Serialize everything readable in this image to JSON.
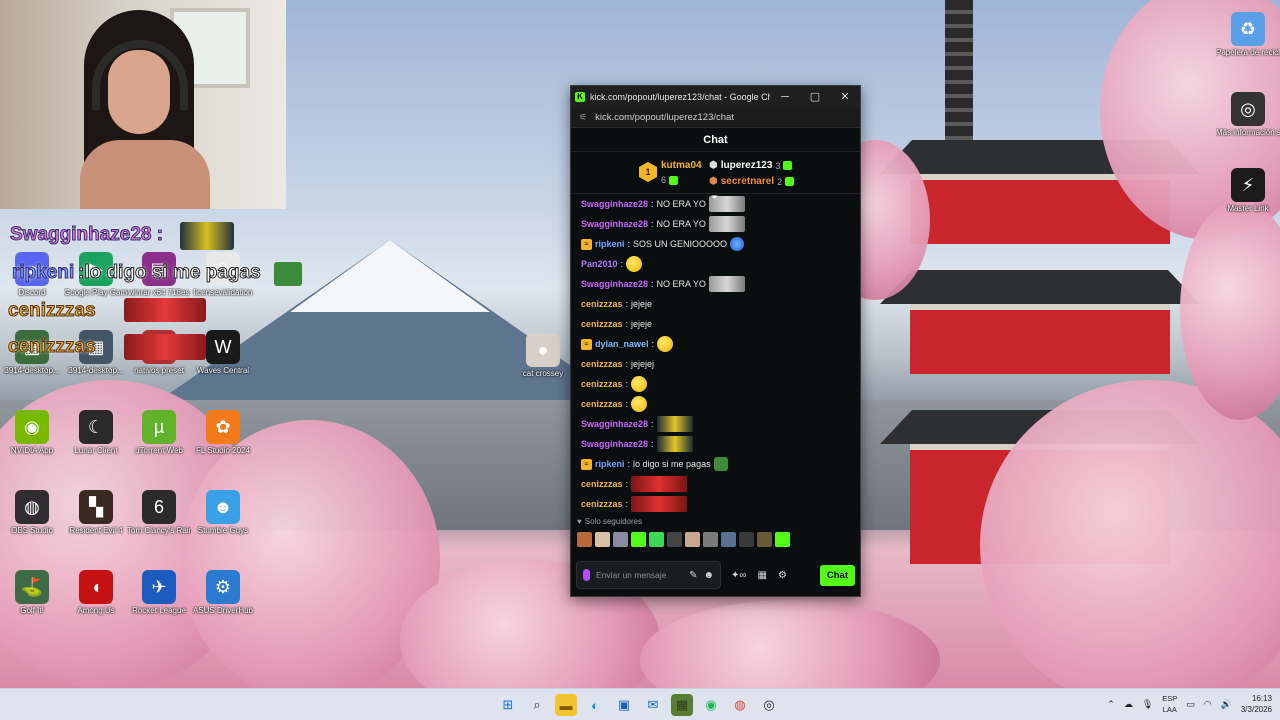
{
  "desktop": {
    "overlay": {
      "swagginhaze_name": "Swagginhaze28",
      "swagginhaze_colon": ":",
      "ripkeni_name": "ripkeni",
      "ripkeni_message": ":lo digo si me pagas",
      "cenizzzas_1": "cenizzzas",
      "cenizzzas_2": "cenizzzas"
    },
    "icons": [
      {
        "label": "Discord",
        "icon": "discord-icon",
        "color": "#5865f2",
        "glyph": "◕"
      },
      {
        "label": "Google Play Games",
        "icon": "google-play-games-icon",
        "color": "#1aa260",
        "glyph": "▶"
      },
      {
        "label": "winrar x64 718es",
        "icon": "winrar-icon",
        "color": "#8c2e8c",
        "glyph": "▤"
      },
      {
        "label": "licensevalidation",
        "icon": "file-icon",
        "color": "#e9e9e9",
        "glyph": "▯"
      },
      {
        "label": "3914-desktop...",
        "icon": "desktop-file-icon",
        "color": "#3b6c3b",
        "glyph": "▦"
      },
      {
        "label": "3914-desktop...",
        "icon": "desktop-file-icon",
        "color": "#445566",
        "glyph": "▦"
      },
      {
        "label": "nativos preset",
        "icon": "preset-icon",
        "color": "#b03030",
        "glyph": "▣"
      },
      {
        "label": "Waves Central",
        "icon": "waves-central-icon",
        "color": "#1a1a1a",
        "glyph": "W"
      },
      {
        "label": "cat crossey",
        "icon": "cat-icon",
        "color": "#d8d0c8",
        "glyph": "●"
      },
      {
        "label": "NVIDIA App",
        "icon": "nvidia-icon",
        "color": "#76b900",
        "glyph": "◉"
      },
      {
        "label": "Lunar Client",
        "icon": "lunar-client-icon",
        "color": "#2a2a2a",
        "glyph": "☾"
      },
      {
        "label": "uTorrent Web",
        "icon": "utorrent-icon",
        "color": "#62b22c",
        "glyph": "µ"
      },
      {
        "label": "FL Studio 2024",
        "icon": "fl-studio-icon",
        "color": "#f27a1a",
        "glyph": "✿"
      },
      {
        "label": "OBS Studio",
        "icon": "obs-icon",
        "color": "#302e31",
        "glyph": "◍"
      },
      {
        "label": "Resident Evil 4",
        "icon": "resident-evil-icon",
        "color": "#3a2a22",
        "glyph": "▚"
      },
      {
        "label": "Tom Clancy's Rainbow Six",
        "icon": "rainbow-six-icon",
        "color": "#2b2b2b",
        "glyph": "6"
      },
      {
        "label": "Stumble Guys",
        "icon": "stumble-guys-icon",
        "color": "#3aa0e6",
        "glyph": "☻"
      },
      {
        "label": "Golf It!",
        "icon": "golf-it-icon",
        "color": "#3d6b46",
        "glyph": "⛳"
      },
      {
        "label": "Among Us",
        "icon": "among-us-icon",
        "color": "#c51111",
        "glyph": "◖"
      },
      {
        "label": "Rocket League",
        "icon": "rocket-league-icon",
        "color": "#1d5bbf",
        "glyph": "✈"
      },
      {
        "label": "ASUS DriverHub",
        "icon": "asus-driverhub-icon",
        "color": "#2d7bd0",
        "glyph": "⚙"
      },
      {
        "label": "Papelera de reciclaje",
        "icon": "recycle-bin-icon",
        "color": "#5aa0e8",
        "glyph": "♻"
      },
      {
        "label": "Más información sobre esta ima...",
        "icon": "info-camera-icon",
        "color": "#333",
        "glyph": "◎"
      },
      {
        "label": "Master Link",
        "icon": "master-link-icon",
        "color": "#1b1b1b",
        "glyph": "⚡"
      }
    ]
  },
  "window": {
    "title": "kick.com/popout/luperez123/chat - Google Chrome",
    "url": "kick.com/popout/luperez123/chat",
    "minimize": "─",
    "maximize": "▢",
    "close": "✕"
  },
  "chat": {
    "header": "Chat",
    "leaderboard": {
      "first": {
        "rank": "1",
        "name": "kutma04",
        "count": "6"
      },
      "second": {
        "name": "luperez123",
        "count": "3"
      },
      "third": {
        "name": "secretnarel",
        "count": "2"
      }
    },
    "pinned_indicator": "⏷",
    "messages": [
      {
        "user": "Swagginhaze28",
        "sep": ":",
        "text": "NO ERA YO",
        "color": "#c766ff",
        "badge": "",
        "emote": "pic"
      },
      {
        "user": "Swagginhaze28",
        "sep": ":",
        "text": "NO ERA YO",
        "color": "#c766ff",
        "badge": "",
        "emote": "pic"
      },
      {
        "user": "ripkeni",
        "sep": ":",
        "text": "SOS UN GENIOOOOO",
        "color": "#6fa3ff",
        "badge": "sub",
        "emote": "globe"
      },
      {
        "user": "Pan2010",
        "sep": ":",
        "text": "",
        "color": "#b07bff",
        "badge": "",
        "emote": "round"
      },
      {
        "user": "Swagginhaze28",
        "sep": ":",
        "text": "NO ERA YO",
        "color": "#c766ff",
        "badge": "",
        "emote": "pic"
      },
      {
        "user": "cenizzzas",
        "sep": ":",
        "text": "jejeje",
        "color": "#f0b440",
        "badge": "",
        "emote": ""
      },
      {
        "user": "cenizzzas",
        "sep": ":",
        "text": "jejeje",
        "color": "#f0b440",
        "badge": "",
        "emote": ""
      },
      {
        "user": "dylan_nawel",
        "sep": ":",
        "text": "",
        "color": "#7fb8ff",
        "badge": "sub",
        "emote": "round"
      },
      {
        "user": "cenizzzas",
        "sep": ":",
        "text": "jejejej",
        "color": "#f0b440",
        "badge": "",
        "emote": ""
      },
      {
        "user": "cenizzzas",
        "sep": ":",
        "text": "",
        "color": "#f0b440",
        "badge": "",
        "emote": "round"
      },
      {
        "user": "cenizzzas",
        "sep": ":",
        "text": "",
        "color": "#f0b440",
        "badge": "",
        "emote": "round"
      },
      {
        "user": "Swagginhaze28",
        "sep": ":",
        "text": "",
        "color": "#c766ff",
        "badge": "",
        "emote": "gold"
      },
      {
        "user": "Swagginhaze28",
        "sep": ":",
        "text": "",
        "color": "#c766ff",
        "badge": "",
        "emote": "gold"
      },
      {
        "user": "ripkeni",
        "sep": ":",
        "text": "lo digo si me pagas",
        "color": "#6fa3ff",
        "badge": "sub",
        "emote": "green"
      },
      {
        "user": "cenizzzas",
        "sep": ":",
        "text": "",
        "color": "#f0b440",
        "badge": "",
        "emote": "red"
      },
      {
        "user": "cenizzzas",
        "sep": ":",
        "text": "",
        "color": "#f0b440",
        "badge": "",
        "emote": "red"
      }
    ],
    "followers_only": "Solo seguidores",
    "input_placeholder": "Enviar un mensaje",
    "send_label": "Chat",
    "accent": "#53fc18"
  },
  "taskbar": {
    "lang_top": "ESP",
    "lang_bottom": "LAA",
    "time": "16:13",
    "date": "3/3/2026"
  }
}
